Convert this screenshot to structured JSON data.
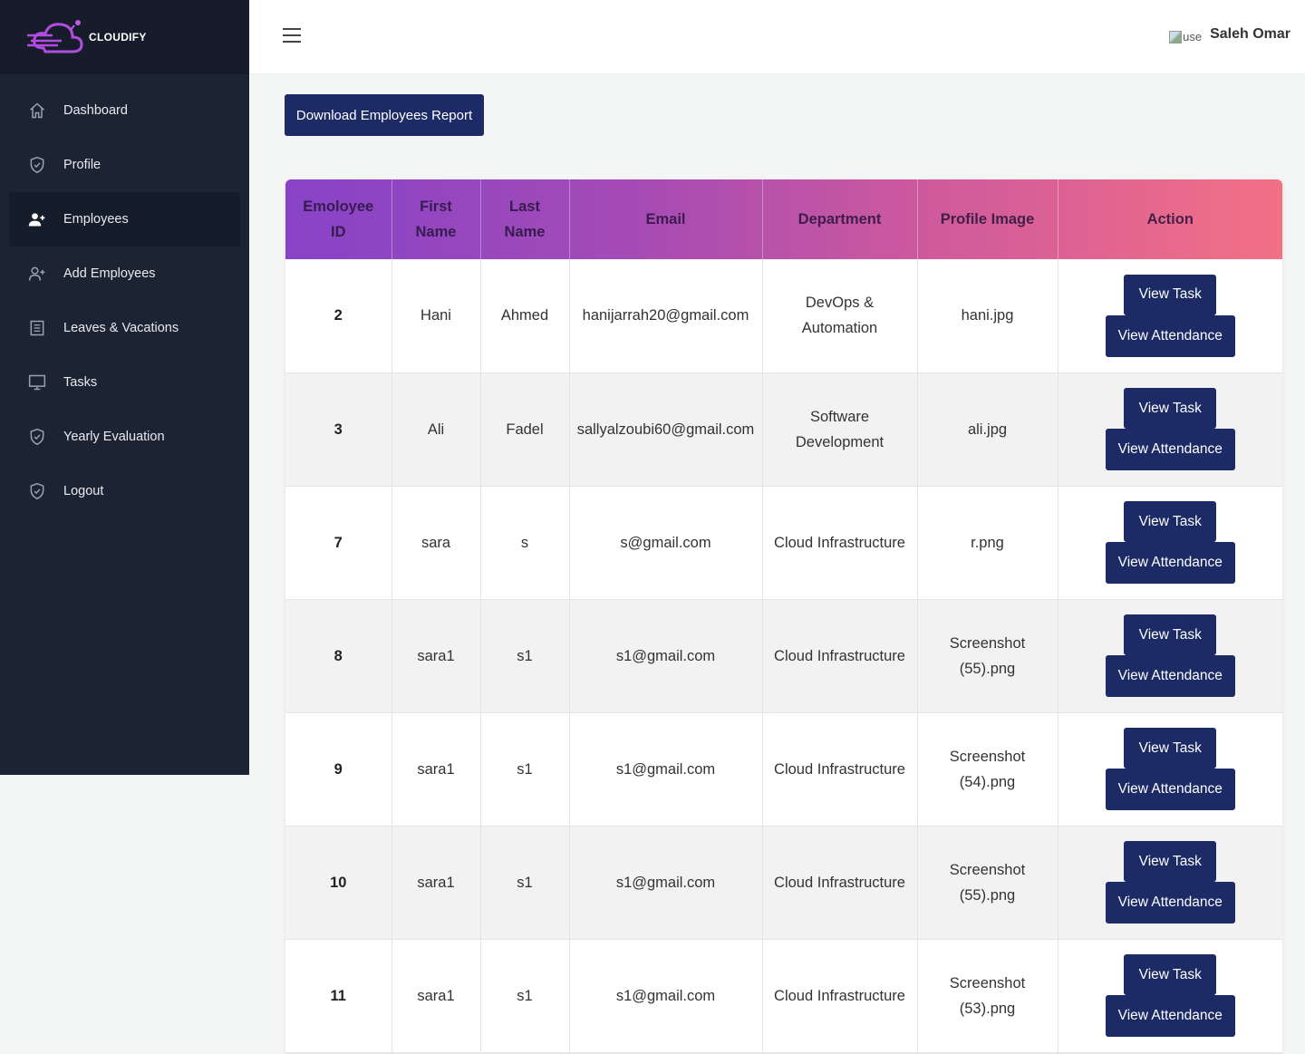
{
  "brand": {
    "name": "CLOUDIFY",
    "accent": "#c25ae8"
  },
  "sidebar": {
    "items": [
      {
        "label": "Dashboard",
        "icon": "home-icon"
      },
      {
        "label": "Profile",
        "icon": "shield-icon"
      },
      {
        "label": "Employees",
        "icon": "user-plus-icon",
        "active": true
      },
      {
        "label": "Add Employees",
        "icon": "user-plus-icon"
      },
      {
        "label": "Leaves & Vacations",
        "icon": "list-icon"
      },
      {
        "label": "Tasks",
        "icon": "monitor-icon"
      },
      {
        "label": "Yearly Evaluation",
        "icon": "shield-icon"
      },
      {
        "label": "Logout",
        "icon": "shield-icon"
      }
    ]
  },
  "header": {
    "avatar_alt": "use",
    "user_name": "Saleh Omar"
  },
  "toolbar": {
    "download_label": "Download Employees Report"
  },
  "table": {
    "columns": [
      {
        "line1": "Emoloyee",
        "line2": "ID"
      },
      {
        "line1": "First",
        "line2": "Name"
      },
      {
        "line1": "Last",
        "line2": "Name"
      },
      {
        "line1": "Email",
        "line2": ""
      },
      {
        "line1": "Department",
        "line2": ""
      },
      {
        "line1": "Profile Image",
        "line2": ""
      },
      {
        "line1": "Action",
        "line2": ""
      }
    ],
    "rows": [
      {
        "id": "2",
        "first": "Hani",
        "last": "Ahmed",
        "email": "hanijarrah20@gmail.com",
        "dept1": "DevOps &",
        "dept2": "Automation",
        "img1": "hani.jpg",
        "img2": ""
      },
      {
        "id": "3",
        "first": "Ali",
        "last": "Fadel",
        "email": "sallyalzoubi60@gmail.com",
        "dept1": "Software",
        "dept2": "Development",
        "img1": "ali.jpg",
        "img2": ""
      },
      {
        "id": "7",
        "first": "sara",
        "last": "s",
        "email": "s@gmail.com",
        "dept1": "Cloud Infrastructure",
        "dept2": "",
        "img1": "r.png",
        "img2": ""
      },
      {
        "id": "8",
        "first": "sara1",
        "last": "s1",
        "email": "s1@gmail.com",
        "dept1": "Cloud Infrastructure",
        "dept2": "",
        "img1": "Screenshot",
        "img2": "(55).png"
      },
      {
        "id": "9",
        "first": "sara1",
        "last": "s1",
        "email": "s1@gmail.com",
        "dept1": "Cloud Infrastructure",
        "dept2": "",
        "img1": "Screenshot",
        "img2": "(54).png"
      },
      {
        "id": "10",
        "first": "sara1",
        "last": "s1",
        "email": "s1@gmail.com",
        "dept1": "Cloud Infrastructure",
        "dept2": "",
        "img1": "Screenshot",
        "img2": "(55).png"
      },
      {
        "id": "11",
        "first": "sara1",
        "last": "s1",
        "email": "s1@gmail.com",
        "dept1": "Cloud Infrastructure",
        "dept2": "",
        "img1": "Screenshot",
        "img2": "(53).png"
      }
    ],
    "actions": {
      "task_label": "View Task",
      "attendance_label": "View Attendance"
    }
  },
  "colors": {
    "sidebar_bg": "#1c2434",
    "button_bg": "#1c2a66",
    "header_gradient_start": "#8743c7",
    "header_gradient_end": "#f37085"
  }
}
